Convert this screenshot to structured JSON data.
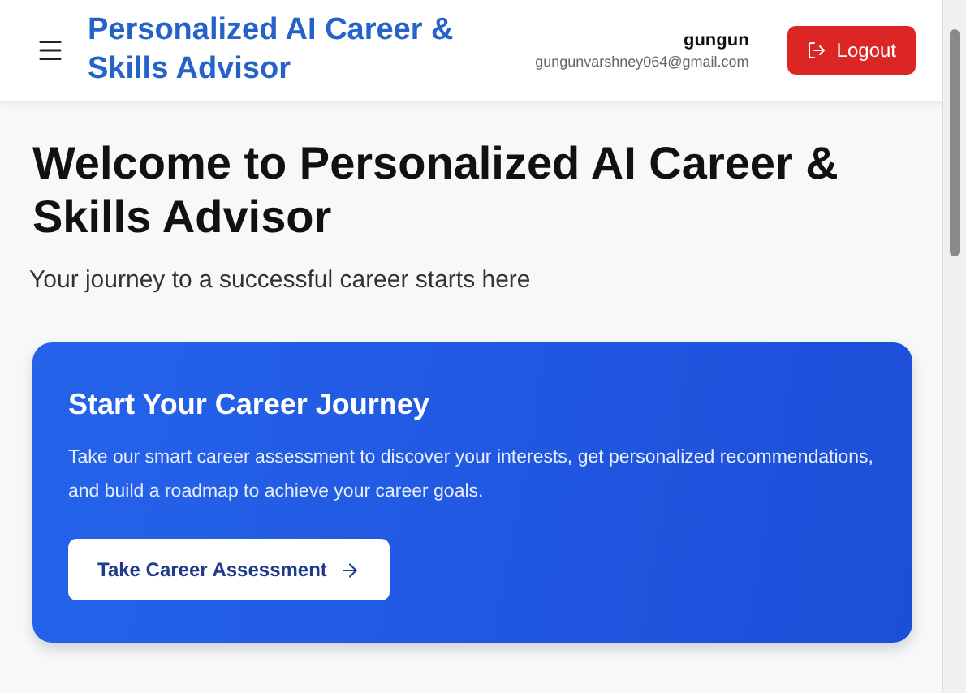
{
  "header": {
    "app_title": "Personalized AI Career & Skills Advisor",
    "user_name": "gungun",
    "user_email": "gungunvarshney064@gmail.com",
    "logout_label": "Logout"
  },
  "welcome": {
    "title": "Welcome to Personalized AI Career & Skills Advisor",
    "subtitle": "Your journey to a successful career starts here"
  },
  "journey_card": {
    "title": "Start Your Career Journey",
    "description": "Take our smart career assessment to discover your interests, get personalized recommendations, and build a roadmap to achieve your career goals.",
    "button_label": "Take Career Assessment"
  }
}
